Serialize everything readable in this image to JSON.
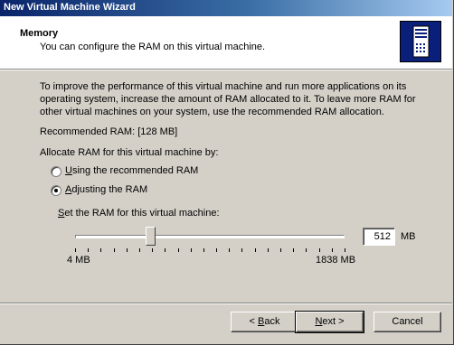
{
  "window": {
    "title": "New Virtual Machine Wizard"
  },
  "header": {
    "title": "Memory",
    "subtitle": "You can configure the RAM on this virtual machine.",
    "icon": "server-icon"
  },
  "content": {
    "intro_lines": [
      "To improve the performance of this virtual machine and run more applications on its",
      "operating system, increase the amount of RAM allocated to it. To leave more RAM for",
      "other virtual machines on your system, use the recommended RAM allocation."
    ],
    "recommended": "Recommended RAM: [128 MB]",
    "allocate_label": "Allocate RAM for this virtual machine by:",
    "options": [
      {
        "label_pre": "",
        "accel": "U",
        "label_post": "sing the recommended RAM",
        "selected": false
      },
      {
        "label_pre": "",
        "accel": "A",
        "label_post": "djusting the RAM",
        "selected": true
      }
    ],
    "set_label_accel": "S",
    "set_label_rest": "et the RAM for this virtual machine:",
    "slider": {
      "min_label": "4 MB",
      "max_label": "1838 MB",
      "position_fraction": 0.28
    },
    "ram_value": "512",
    "ram_unit": "MB"
  },
  "buttons": {
    "back_pre": "< ",
    "back_accel": "B",
    "back_post": "ack",
    "next_accel": "N",
    "next_post": "ext >",
    "cancel": "Cancel"
  },
  "colors": {
    "title_start": "#0a246a",
    "title_end": "#a6caf0",
    "face": "#d4d0c8",
    "icon_bg": "#0a1f7a"
  }
}
